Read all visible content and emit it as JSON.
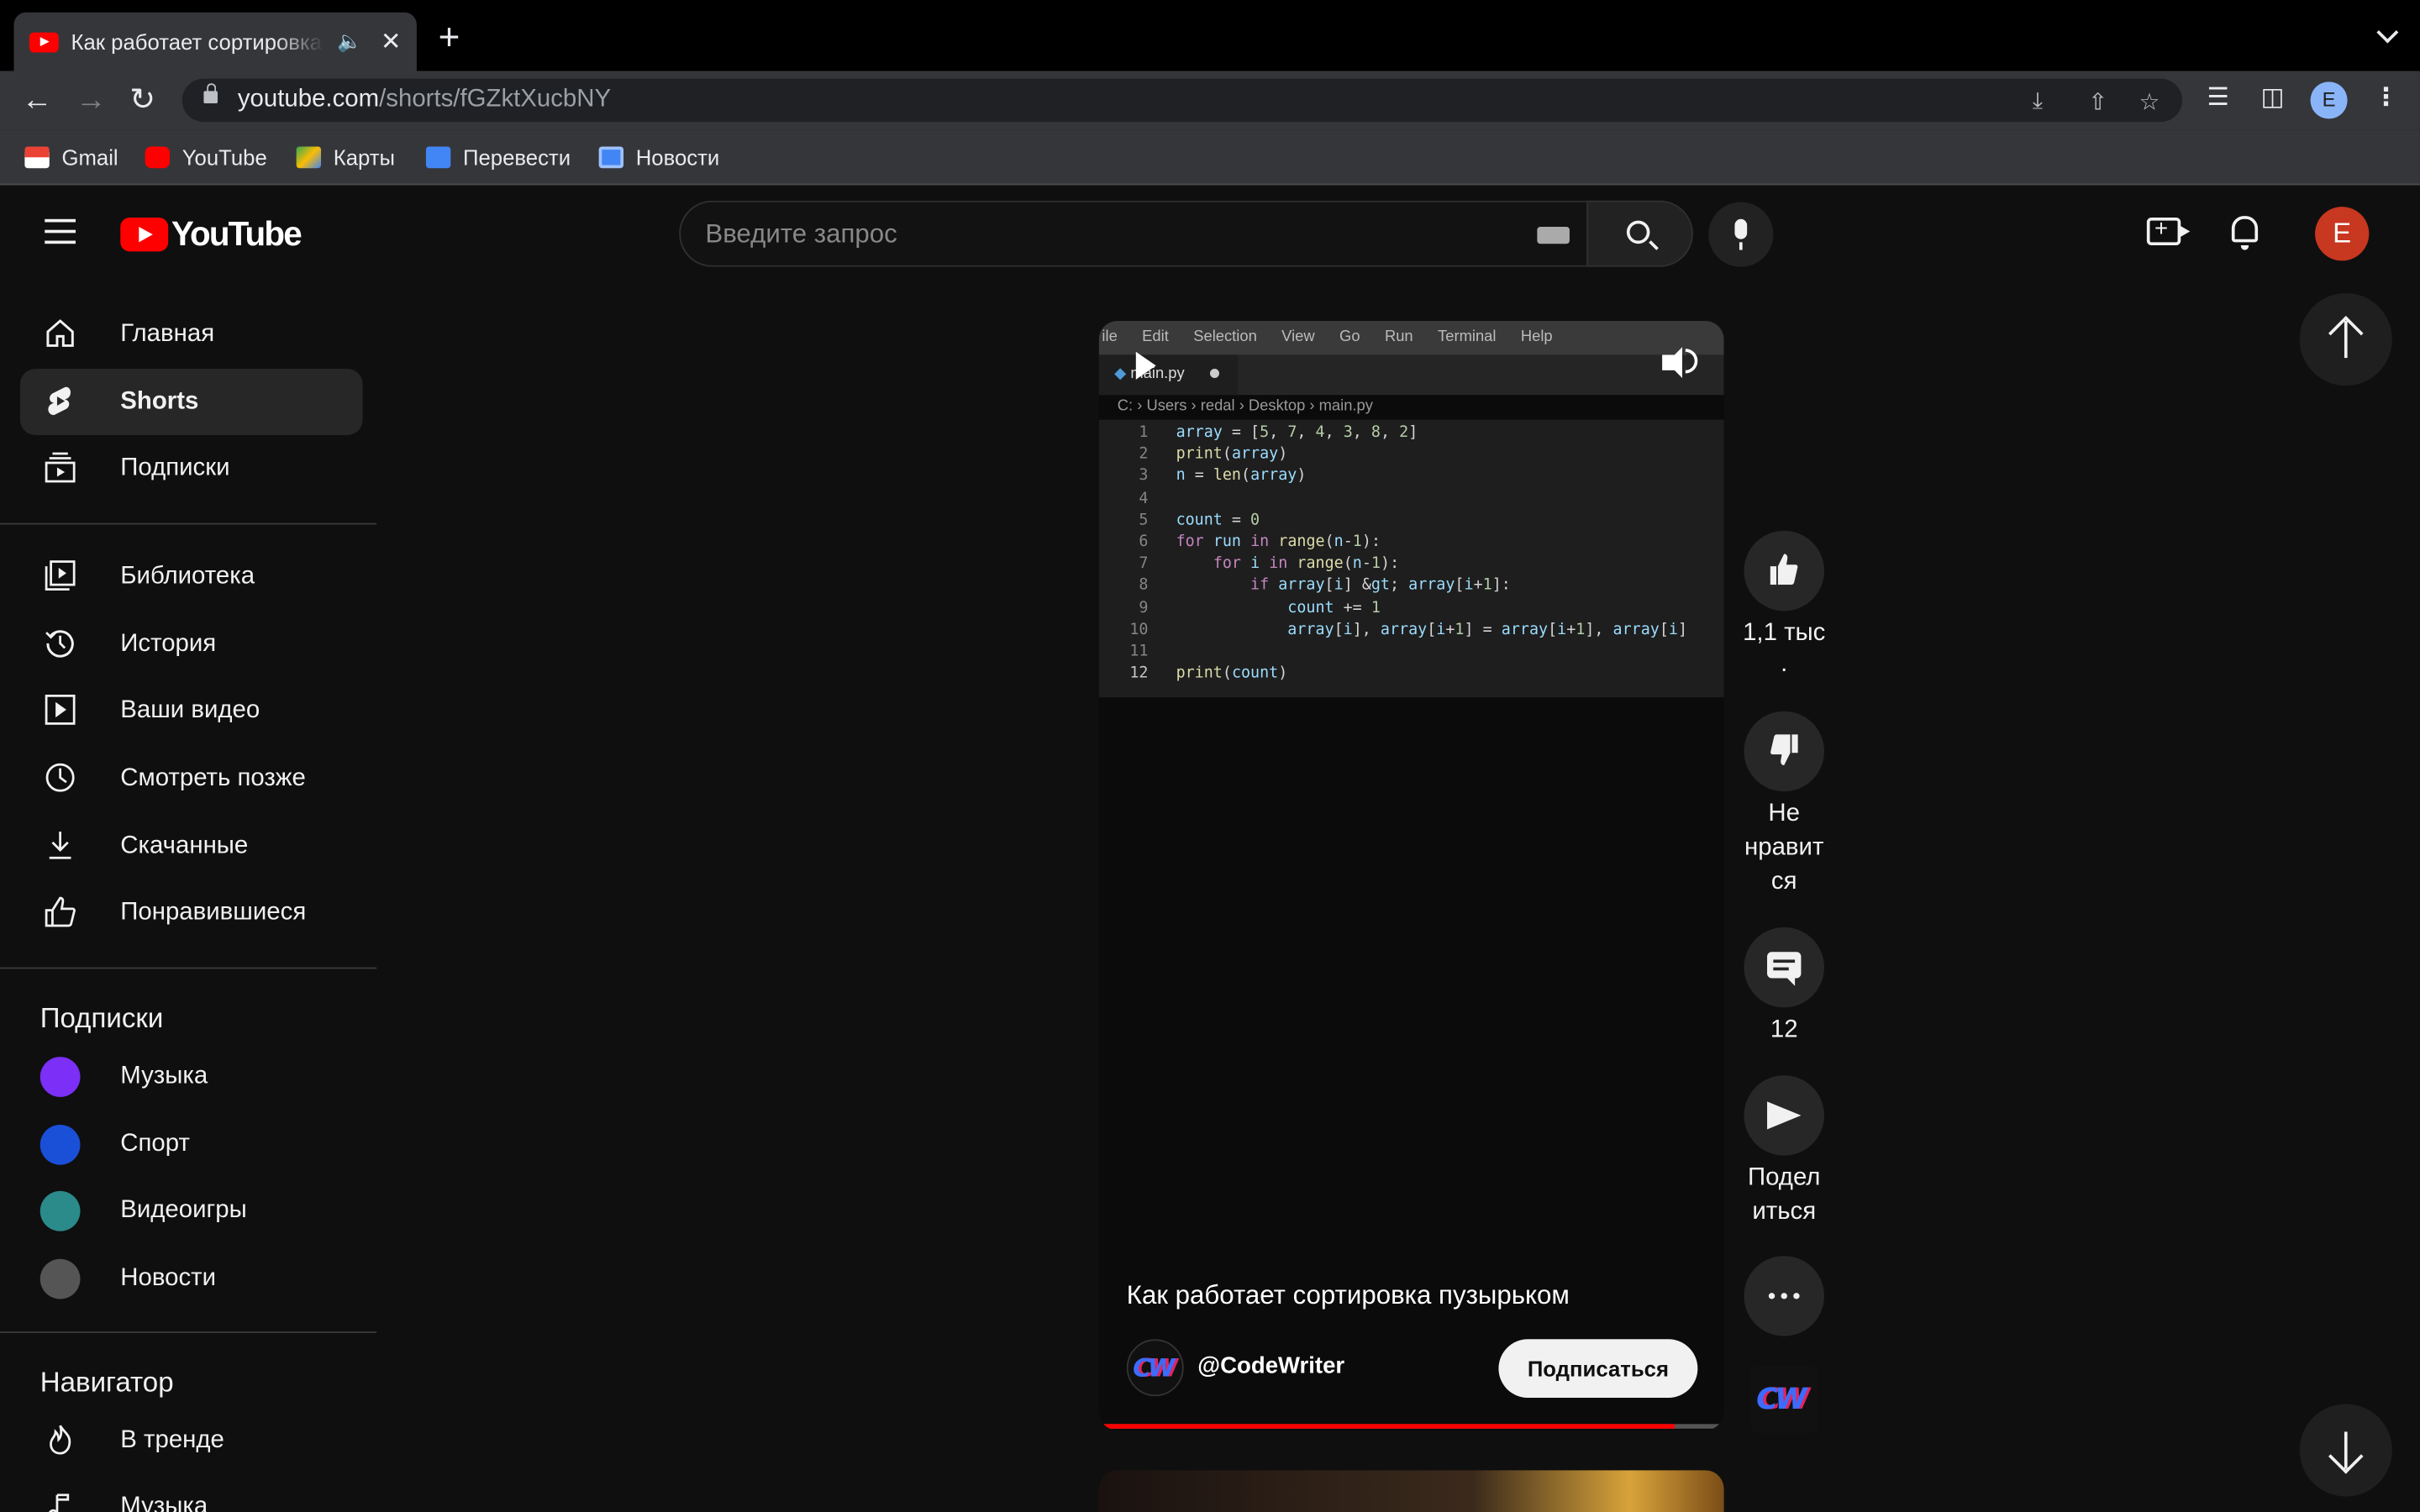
{
  "browser": {
    "tab_title": "Как работает сортировка пузырьком - YouTube",
    "url_host": "youtube.com",
    "url_path": "/shorts/fGZktXucbNY",
    "profile_initial": "E",
    "bookmarks": [
      {
        "label": "Gmail",
        "icon": "gmail-icon",
        "color": "#ea4335"
      },
      {
        "label": "YouTube",
        "icon": "youtube-icon",
        "color": "#ff0000"
      },
      {
        "label": "Карты",
        "icon": "maps-icon",
        "color": "#34a853"
      },
      {
        "label": "Перевести",
        "icon": "translate-icon",
        "color": "#4285f4"
      },
      {
        "label": "Новости",
        "icon": "news-icon",
        "color": "#4285f4"
      }
    ]
  },
  "masthead": {
    "logo_text": "YouTube",
    "search_placeholder": "Введите запрос",
    "avatar_initial": "E",
    "avatar_color": "#c8371f"
  },
  "sidebar": {
    "main": [
      {
        "label": "Главная",
        "icon": "home-icon"
      },
      {
        "label": "Shorts",
        "icon": "shorts-icon",
        "active": true
      },
      {
        "label": "Подписки",
        "icon": "subscriptions-icon"
      }
    ],
    "library": [
      {
        "label": "Библиотека",
        "icon": "library-icon"
      },
      {
        "label": "История",
        "icon": "history-icon"
      },
      {
        "label": "Ваши видео",
        "icon": "your-videos-icon"
      },
      {
        "label": "Смотреть позже",
        "icon": "watch-later-icon"
      },
      {
        "label": "Скачанные",
        "icon": "download-icon"
      },
      {
        "label": "Понравившиеся",
        "icon": "liked-icon"
      }
    ],
    "subscriptions_heading": "Подписки",
    "subscriptions": [
      {
        "label": "Музыка",
        "color": "#7b2ff7"
      },
      {
        "label": "Спорт",
        "color": "#1a4fd8"
      },
      {
        "label": "Видеоигры",
        "color": "#2b8a8a"
      },
      {
        "label": "Новости",
        "color": "#555555"
      }
    ],
    "navigator_heading": "Навигатор",
    "navigator": [
      {
        "label": "В тренде",
        "icon": "trending-icon"
      },
      {
        "label": "Музыка",
        "icon": "music-icon"
      }
    ]
  },
  "short": {
    "title": "Как работает сортировка пузырьком",
    "channel": "@CodeWriter",
    "channel_logo": "CW",
    "subscribe_label": "Подписаться",
    "progress": 0.92,
    "editor": {
      "menu": [
        "ile",
        "Edit",
        "Selection",
        "View",
        "Go",
        "Run",
        "Terminal",
        "Help"
      ],
      "file_tab": "main.py",
      "breadcrumb": "C: › Users › redal › Desktop › main.py",
      "lines": [
        "array = [5, 7, 4, 3, 8, 2]",
        "print(array)",
        "n = len(array)",
        "",
        "count = 0",
        "for run in range(n-1):",
        "    for i in range(n-1):",
        "        if array[i] > array[i+1]:",
        "            count += 1",
        "            array[i], array[i+1] = array[i+1], array[i]",
        "",
        "print(count)"
      ]
    }
  },
  "actions": {
    "like_label_1": "1,1 тыс",
    "like_label_2": ".",
    "dislike_label_1": "Не",
    "dislike_label_2": "нравит",
    "dislike_label_3": "ся",
    "comments_count": "12",
    "share_label_1": "Подел",
    "share_label_2": "иться"
  }
}
